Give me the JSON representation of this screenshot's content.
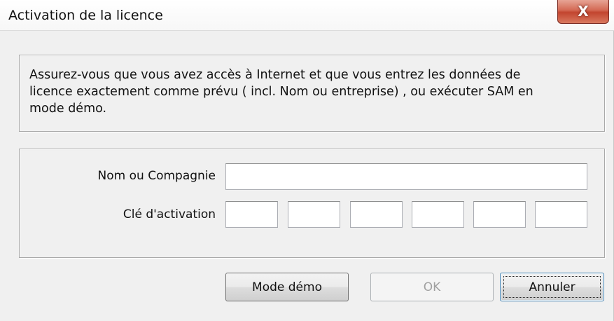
{
  "window": {
    "title": "Activation de la licence",
    "close_glyph": "X"
  },
  "info": {
    "text": "Assurez-vous que vous avez accès à Internet et que vous entrez les données de\nlicence exactement comme prévu ( incl. Nom ou entreprise) , ou exécuter SAM en\nmode démo."
  },
  "form": {
    "name_label": "Nom ou Compagnie",
    "name_value": "",
    "key_label": "Clé d'activation",
    "key_fields": [
      "",
      "",
      "",
      "",
      "",
      ""
    ]
  },
  "buttons": {
    "demo_label": "Mode démo",
    "ok_label": "OK",
    "cancel_label": "Annuler"
  }
}
